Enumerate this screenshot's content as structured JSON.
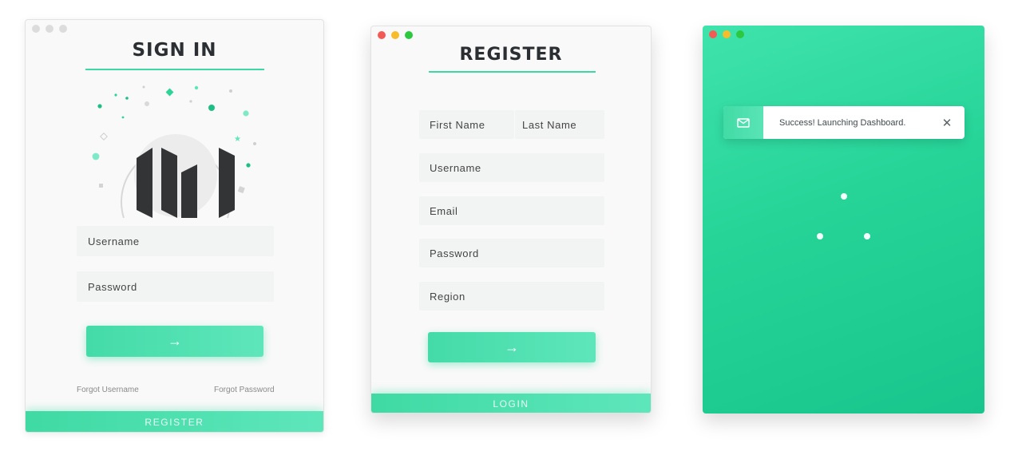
{
  "signin": {
    "title": "SIGN IN",
    "username_placeholder": "Username",
    "password_placeholder": "Password",
    "submit_arrow": "→",
    "forgot_username": "Forgot Username",
    "forgot_password": "Forgot Password",
    "register_label": "REGISTER"
  },
  "register": {
    "title": "REGISTER",
    "first_name_placeholder": "First Name",
    "last_name_placeholder": "Last Name",
    "username_placeholder": "Username",
    "email_placeholder": "Email",
    "password_placeholder": "Password",
    "region_placeholder": "Region",
    "submit_arrow": "→",
    "login_label": "LOGIN"
  },
  "success": {
    "message": "Success! Launching Dashboard.",
    "close_glyph": "✕"
  },
  "colors": {
    "accent": "#3dd9a2",
    "success_bg": "#26d498",
    "title_text": "#2b2f33",
    "field_bg": "#f2f3f3"
  },
  "icons": [
    "logo-icon",
    "arrow-right-icon",
    "mail-icon",
    "close-icon",
    "loading-spinner-icon"
  ]
}
